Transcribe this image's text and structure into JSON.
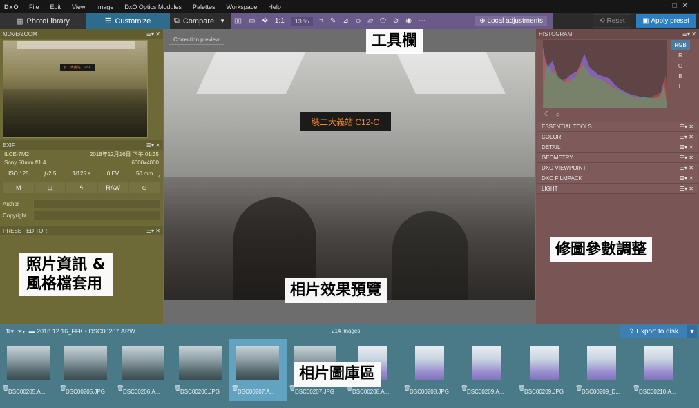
{
  "app": {
    "logo": "DxO"
  },
  "menubar": {
    "items": [
      "File",
      "Edit",
      "View",
      "Image",
      "DxO Optics Modules",
      "Palettes",
      "Workspace",
      "Help"
    ]
  },
  "tabs": {
    "photolibrary": "PhotoLibrary",
    "customize": "Customize",
    "compare": "Compare"
  },
  "toolbar": {
    "zoom_ratio": "1:1",
    "zoom_percent": "13 %",
    "local_adjustments": "Local adjustments",
    "reset": "Reset",
    "apply_preset": "Apply preset"
  },
  "left": {
    "movezoom_title": "MOVE/ZOOM",
    "thumb_sign": "前二大義站 C12-C",
    "exif_title": "EXIF",
    "camera": "ILCE-7M2",
    "datetime": "2018年12月16日 下午 01:35",
    "lens": "Sony 50mm f/1.4",
    "resolution": "6000x4000",
    "iso": "ISO 125",
    "aperture": "ƒ/2.5",
    "shutter": "1/125 s",
    "ev": "0 EV",
    "focal": "50 mm",
    "mode": "-M-",
    "format": "RAW",
    "author_label": "Author",
    "copyright_label": "Copyright",
    "preset_title": "PRESET EDITOR"
  },
  "center": {
    "correction_preview": "Correction preview",
    "sign": "裝二大義站 C12-C"
  },
  "right": {
    "histogram_title": "HISTOGRAM",
    "channels": [
      "RGB",
      "R",
      "G",
      "B",
      "L"
    ],
    "palettes": [
      "ESSENTIAL TOOLS",
      "COLOR",
      "DETAIL",
      "GEOMETRY",
      "DXO VIEWPOINT",
      "DXO FILMPACK",
      "LIGHT"
    ]
  },
  "bottom": {
    "path": "2018.12.16_FFK",
    "current_file": "DSC00207.ARW",
    "count": "214 images",
    "export": "Export to disk",
    "films": [
      {
        "name": "DSC00205.A...",
        "cos": false,
        "sel": false
      },
      {
        "name": "DSC00205.JPG",
        "cos": false,
        "sel": false
      },
      {
        "name": "DSC00206.A...",
        "cos": false,
        "sel": false
      },
      {
        "name": "DSC00206.JPG",
        "cos": false,
        "sel": false
      },
      {
        "name": "DSC00207.A...",
        "cos": false,
        "sel": true
      },
      {
        "name": "DSC00207.JPG",
        "cos": false,
        "sel": false
      },
      {
        "name": "DSC00208.A...",
        "cos": true,
        "sel": false
      },
      {
        "name": "DSC00208.JPG",
        "cos": true,
        "sel": false
      },
      {
        "name": "DSC00209.A...",
        "cos": true,
        "sel": false
      },
      {
        "name": "DSC00209.JPG",
        "cos": true,
        "sel": false
      },
      {
        "name": "DSC00209_D...",
        "cos": true,
        "sel": false
      },
      {
        "name": "DSC00210.A...",
        "cos": true,
        "sel": false
      }
    ]
  },
  "annotations": {
    "toolbar": "工具欄",
    "left1": "照片資訊 &",
    "left2": "風格檔套用",
    "center": "相片效果預覽",
    "right": "修圖參數調整",
    "gallery": "相片圖庫區"
  }
}
